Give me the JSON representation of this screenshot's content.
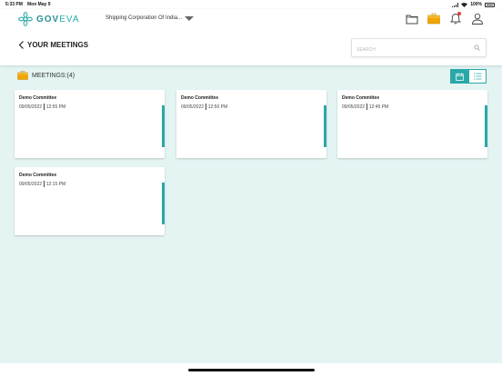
{
  "status_bar": {
    "time": "5:33 PM",
    "date": "Mon May 9",
    "battery": "100%"
  },
  "header": {
    "logo_brand_gov": "GOV",
    "logo_brand_eva": "EVA",
    "organization": "Shipping Corporation Of India...",
    "icons": [
      "folder-icon",
      "briefcase-icon",
      "bell-icon",
      "user-icon"
    ]
  },
  "page": {
    "title": "YOUR MEETINGS",
    "search_placeholder": "SEARCH",
    "meetings_label": "MEETINGS:(4)"
  },
  "colors": {
    "accent": "#2aa8a8",
    "background": "#e3f4f3",
    "notification": "#e53b3b"
  },
  "meetings": [
    {
      "title": "Demo Committee",
      "date": "09/05/2022",
      "time": "12:55 PM"
    },
    {
      "title": "Demo Committee",
      "date": "09/05/2022",
      "time": "12:50 PM"
    },
    {
      "title": "Demo Committee",
      "date": "09/05/2022",
      "time": "12:45 PM"
    },
    {
      "title": "Demo Committee",
      "date": "09/05/2022",
      "time": "12:15 PM"
    }
  ]
}
